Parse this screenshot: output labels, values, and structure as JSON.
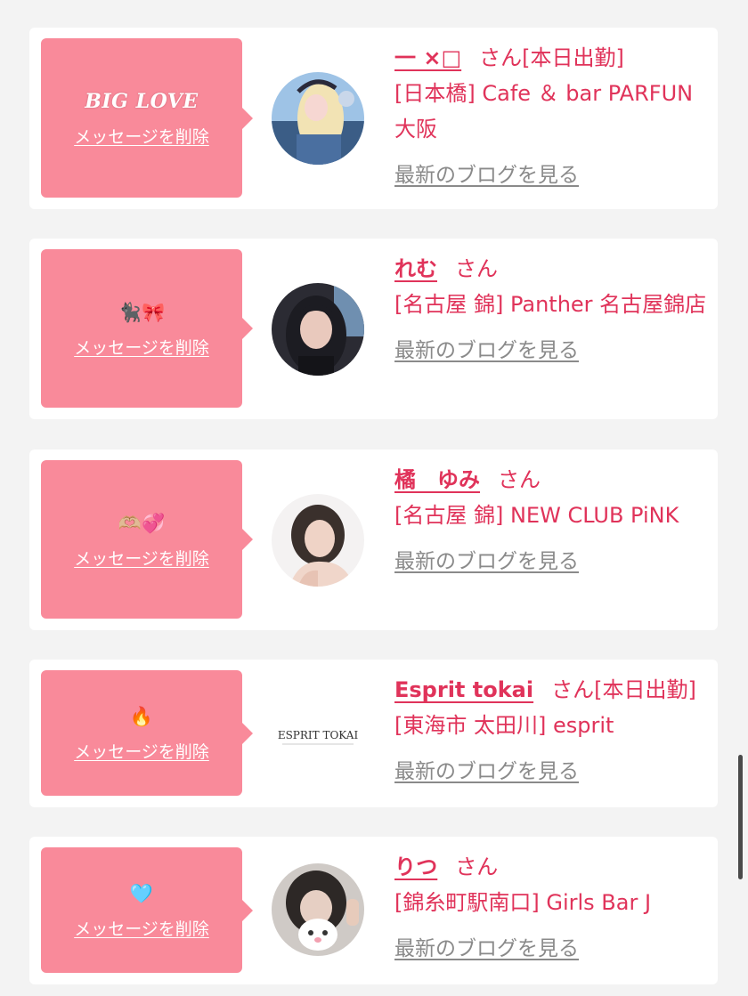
{
  "favorites": [
    {
      "message": "BIG LOVE",
      "delete_label": "メッセージを削除",
      "avatar_icon": "avatar-photo-blonde-cosplay",
      "name": "一 ×□",
      "suffix": "さん[本日出勤]",
      "shop": "[日本橋] Cafe ＆ bar PARFUN 大阪",
      "blog_label": "最新のブログを見る"
    },
    {
      "message": "🐈‍⬛🎀",
      "delete_label": "メッセージを削除",
      "avatar_icon": "avatar-photo-dark-hair",
      "name": "れむ",
      "suffix": "さん",
      "shop": "[名古屋 錦] Panther 名古屋錦店",
      "blog_label": "最新のブログを見る"
    },
    {
      "message": "🫶🏼💞",
      "delete_label": "メッセージを削除",
      "avatar_icon": "avatar-photo-brown-hair",
      "name": "橘　ゆみ",
      "suffix": "さん",
      "shop": "[名古屋 錦] NEW CLUB PiNK",
      "blog_label": "最新のブログを見る"
    },
    {
      "message": "🔥",
      "delete_label": "メッセージを削除",
      "avatar_icon": "avatar-logo-esprit-tokai",
      "avatar_text": "ESPRIT TOKAI",
      "name": "Esprit tokai",
      "suffix": "さん[本日出勤]",
      "shop": "[東海市 太田川] esprit",
      "blog_label": "最新のブログを見る"
    },
    {
      "message": "🩵",
      "delete_label": "メッセージを削除",
      "avatar_icon": "avatar-photo-with-mascot-sticker",
      "name": "りつ",
      "suffix": "さん",
      "shop": "[錦糸町駅南口] Girls Bar J",
      "blog_label": "最新のブログを見る"
    }
  ],
  "colors": {
    "accent_pink": "#e0335a",
    "bubble_pink": "#f98a9a",
    "link_gray": "#8a8a8a",
    "background": "#f3f3f3",
    "card": "#ffffff"
  }
}
